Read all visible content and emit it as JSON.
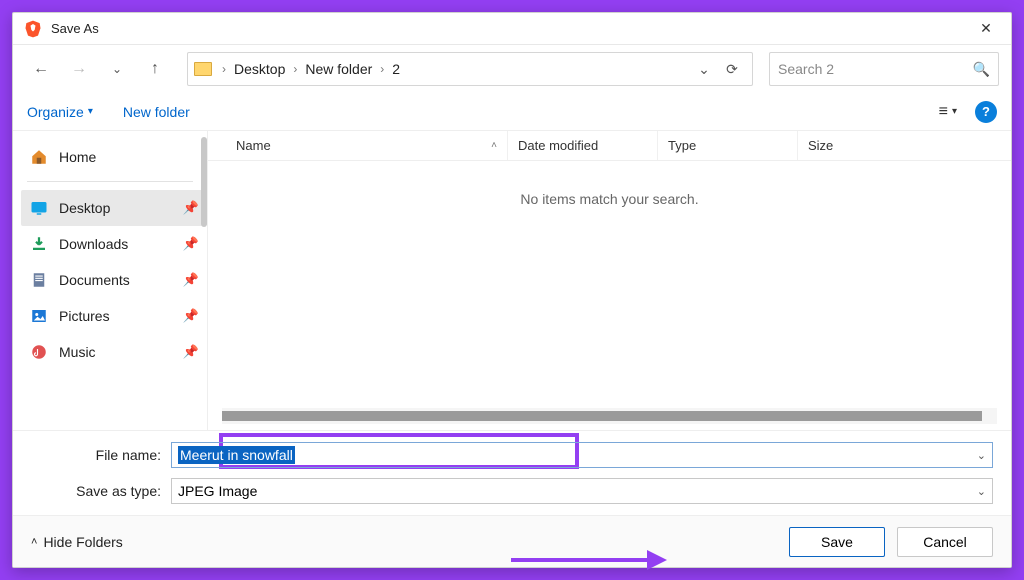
{
  "window": {
    "title": "Save As"
  },
  "nav": {
    "breadcrumbs": [
      "Desktop",
      "New folder",
      "2"
    ],
    "search_placeholder": "Search 2"
  },
  "toolbar": {
    "organize": "Organize",
    "new_folder": "New folder"
  },
  "sidebar": {
    "items": [
      {
        "icon": "home-icon",
        "label": "Home",
        "pinned": false
      },
      {
        "icon": "desktop-icon",
        "label": "Desktop",
        "pinned": true,
        "selected": true
      },
      {
        "icon": "download-icon",
        "label": "Downloads",
        "pinned": true
      },
      {
        "icon": "document-icon",
        "label": "Documents",
        "pinned": true
      },
      {
        "icon": "picture-icon",
        "label": "Pictures",
        "pinned": true
      },
      {
        "icon": "music-icon",
        "label": "Music",
        "pinned": true
      }
    ]
  },
  "columns": {
    "name": "Name",
    "date": "Date modified",
    "type": "Type",
    "size": "Size"
  },
  "content": {
    "empty_message": "No items match your search."
  },
  "form": {
    "filename_label": "File name:",
    "filename_value": "Meerut in snowfall",
    "savetype_label": "Save as type:",
    "savetype_value": "JPEG Image"
  },
  "footer": {
    "hide_folders": "Hide Folders",
    "save": "Save",
    "cancel": "Cancel"
  },
  "colors": {
    "accent": "#933ff2",
    "selection": "#0a64c2"
  }
}
